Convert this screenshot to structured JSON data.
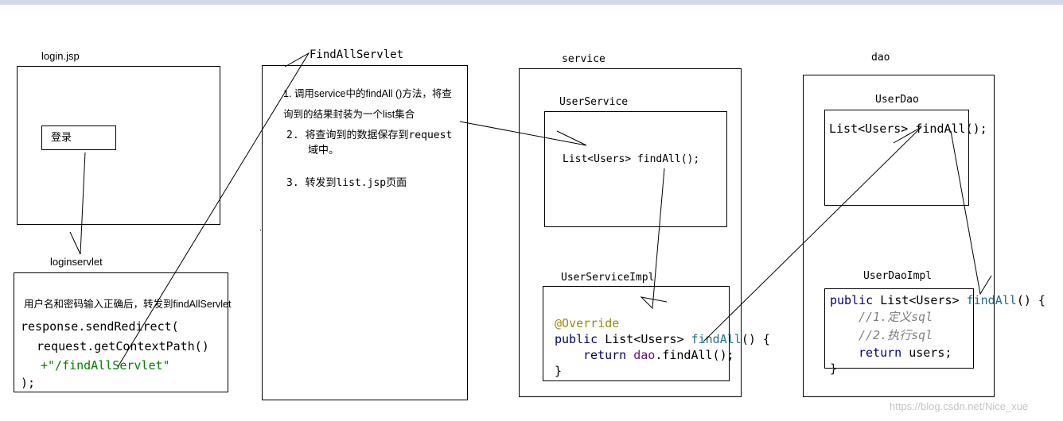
{
  "login_jsp": {
    "title": "login.jsp",
    "button": "登录"
  },
  "loginservlet": {
    "title": "loginservlet",
    "note": "用户名和密码输入正确后，转发到findAllServlet",
    "code": [
      "response.sendRedirect(",
      "request.getContextPath()",
      "+\"/findAllServlet\"",
      ");"
    ]
  },
  "findall_servlet": {
    "title": "FindAllServlet",
    "step1_line1": "1. 调用service中的findAll ()方法，将查",
    "step1_line2": "询到的结果封装为一个list集合",
    "step2_line1": "2. 将查询到的数据保存到request",
    "step2_line2": "域中。",
    "step3": "3. 转发到list.jsp页面"
  },
  "service": {
    "title": "service",
    "interface_title": "UserService",
    "interface_method": "List<Users> findAll();",
    "impl_title": "UserServiceImpl",
    "impl_code": {
      "annotation": "@Override",
      "sig_kw": "public",
      "sig_type": "List<Users>",
      "sig_fn": "findAll",
      "sig_end": "() {",
      "ret_kw": "return",
      "ret_field": "dao",
      "ret_rest": ".findAll();",
      "close": "}"
    }
  },
  "dao": {
    "title": "dao",
    "interface_title": "UserDao",
    "interface_method": "List<Users> findAll();",
    "impl_title": "UserDaoImpl",
    "impl_code": {
      "sig_kw": "public",
      "sig_type": "List<Users>",
      "sig_fn": "findAll",
      "sig_end": "() {",
      "comment1": "//1.定义sql",
      "comment2": "//2.执行sql",
      "ret_kw": "return",
      "ret_rest": "users;",
      "close": "}"
    }
  },
  "watermark": "https://blog.csdn.net/Nice_xue"
}
